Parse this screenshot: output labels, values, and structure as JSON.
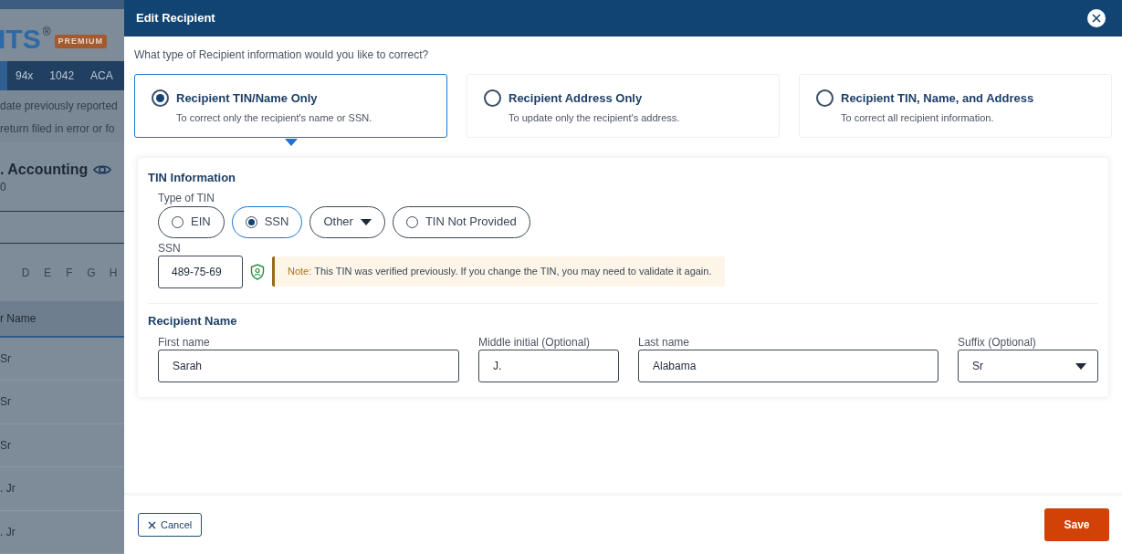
{
  "background": {
    "logo": "ITS",
    "logo_mark": "®",
    "badge": "PREMIUM",
    "tabs": [
      {
        "label": "94x",
        "selected": false
      },
      {
        "label": "1042",
        "selected": false
      },
      {
        "label": "ACA",
        "selected": false
      }
    ],
    "lines": [
      "date previously reported",
      "return filed in error or fo"
    ],
    "company": ". Accounting",
    "company_sub": "0",
    "letters": [
      "D",
      "E",
      "F",
      "G",
      "H"
    ],
    "column_header": "r Name",
    "rows": [
      "Sr",
      "Sr",
      "Sr",
      ". Jr",
      ". Jr"
    ]
  },
  "modal": {
    "title": "Edit Recipient",
    "question": "What type of Recipient information would you like to correct?",
    "options": [
      {
        "title": "Recipient TIN/Name Only",
        "description": "To correct only the recipient's name or SSN.",
        "selected": true
      },
      {
        "title": "Recipient Address Only",
        "description": "To update only the recipient's address.",
        "selected": false
      },
      {
        "title": "Recipient TIN, Name, and Address",
        "description": "To correct all recipient information.",
        "selected": false
      }
    ],
    "tin": {
      "title": "TIN Information",
      "type_label": "Type of TIN",
      "types": [
        {
          "kind": "radio",
          "label": "EIN",
          "selected": false
        },
        {
          "kind": "radio",
          "label": "SSN",
          "selected": true
        },
        {
          "kind": "dropdown",
          "label": "Other",
          "selected": false
        },
        {
          "kind": "radio",
          "label": "TIN Not Provided",
          "selected": false
        }
      ],
      "ssn_label": "SSN",
      "ssn_value": "489-75-69",
      "verified": true,
      "note_label": "Note:",
      "note": "This TIN was verified previously. If you change the TIN, you may need to validate it again."
    },
    "name": {
      "title": "Recipient Name",
      "fields": [
        {
          "kind": "text",
          "label": "First name",
          "value": "Sarah"
        },
        {
          "kind": "text",
          "label": "Middle initial (Optional)",
          "value": "J."
        },
        {
          "kind": "text",
          "label": "Last name",
          "value": "Alabama"
        },
        {
          "kind": "select",
          "label": "Suffix (Optional)",
          "value": "Sr"
        }
      ]
    },
    "cancel": "Cancel",
    "save": "Save"
  }
}
